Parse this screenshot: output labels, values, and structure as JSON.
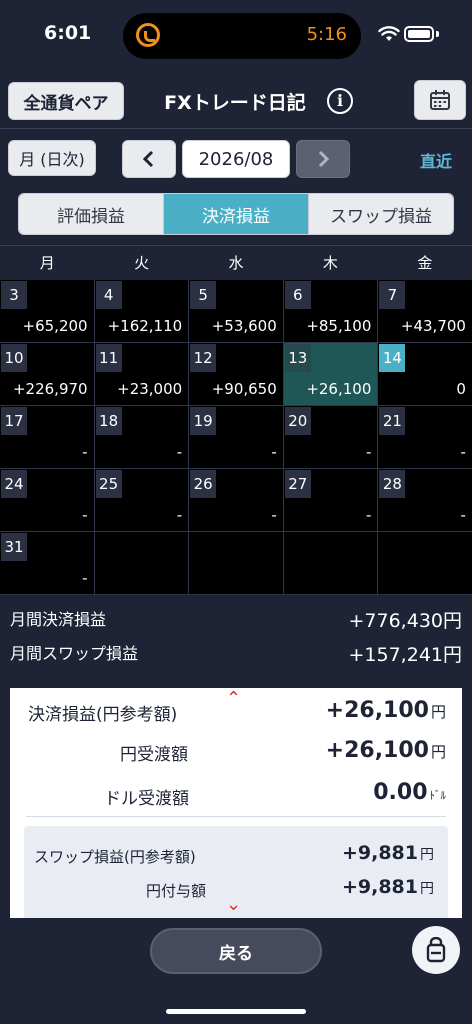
{
  "status": {
    "time": "6:01",
    "timer": "5:16"
  },
  "header": {
    "pairs_button": "全通貨ペア",
    "title": "FXトレード日記",
    "info_glyph": "i"
  },
  "nav": {
    "mode": "月 (日次)",
    "month": "2026/08",
    "recent": "直近"
  },
  "tabs": [
    {
      "label": "評価損益",
      "active": false
    },
    {
      "label": "決済損益",
      "active": true
    },
    {
      "label": "スワップ損益",
      "active": false
    }
  ],
  "calendar": {
    "weekdays": [
      "月",
      "火",
      "水",
      "木",
      "金"
    ],
    "rows": [
      [
        {
          "day": "3",
          "pl": "+65,200"
        },
        {
          "day": "4",
          "pl": "+162,110"
        },
        {
          "day": "5",
          "pl": "+53,600"
        },
        {
          "day": "6",
          "pl": "+85,100"
        },
        {
          "day": "7",
          "pl": "+43,700"
        }
      ],
      [
        {
          "day": "10",
          "pl": "+226,970"
        },
        {
          "day": "11",
          "pl": "+23,000"
        },
        {
          "day": "12",
          "pl": "+90,650"
        },
        {
          "day": "13",
          "pl": "+26,100"
        },
        {
          "day": "14",
          "pl": "0"
        }
      ],
      [
        {
          "day": "17",
          "pl": "-"
        },
        {
          "day": "18",
          "pl": "-"
        },
        {
          "day": "19",
          "pl": "-"
        },
        {
          "day": "20",
          "pl": "-"
        },
        {
          "day": "21",
          "pl": "-"
        }
      ],
      [
        {
          "day": "24",
          "pl": "-"
        },
        {
          "day": "25",
          "pl": "-"
        },
        {
          "day": "26",
          "pl": "-"
        },
        {
          "day": "27",
          "pl": "-"
        },
        {
          "day": "28",
          "pl": "-"
        }
      ],
      [
        {
          "day": "31",
          "pl": "-"
        },
        {
          "day": "",
          "pl": ""
        },
        {
          "day": "",
          "pl": ""
        },
        {
          "day": "",
          "pl": ""
        },
        {
          "day": "",
          "pl": ""
        }
      ]
    ],
    "selected_day": "13",
    "today": "14"
  },
  "summary": {
    "monthly_settled_label": "月間決済損益",
    "monthly_settled_value": "+776,430円",
    "monthly_swap_label": "月間スワップ損益",
    "monthly_swap_value": "+157,241円"
  },
  "detail": {
    "settled_label": "決済損益(円参考額)",
    "settled_value": "+26,100",
    "yen_delivery_label": "円受渡額",
    "yen_delivery_value": "+26,100",
    "usd_delivery_label": "ドル受渡額",
    "usd_delivery_value": "0.00",
    "yen_unit": "円",
    "usd_unit": "ﾄﾞﾙ",
    "swap_label": "スワップ損益(円参考額)",
    "swap_value": "+9,881",
    "yen_grant_label": "円付与額",
    "yen_grant_value": "+9,881"
  },
  "footer": {
    "back_button": "戻る",
    "fab_glyph": "⌂"
  },
  "colors": {
    "accent": "#4ab0c6",
    "background": "#1e2436",
    "cell": "#000000",
    "selected": "#1f5656",
    "alert": "#e0302c"
  }
}
